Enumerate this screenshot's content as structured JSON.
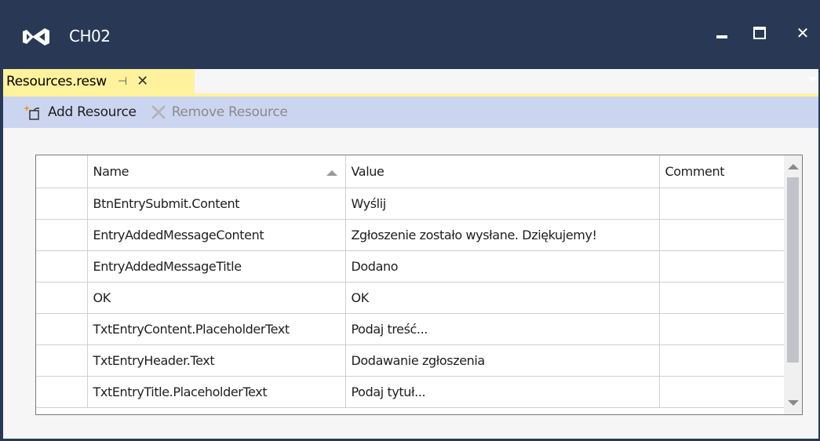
{
  "window": {
    "title": "CH02"
  },
  "tab": {
    "label": "Resources.resw",
    "pin_glyph": "⊣",
    "close_glyph": "✕"
  },
  "toolbar": {
    "add_label": "Add Resource",
    "remove_label": "Remove Resource"
  },
  "grid": {
    "columns": [
      "Name",
      "Value",
      "Comment"
    ],
    "sort_column": "Name",
    "sort_direction": "ascending",
    "rows": [
      {
        "name": "BtnEntrySubmit.Content",
        "value": "Wyślij",
        "comment": ""
      },
      {
        "name": "EntryAddedMessageContent",
        "value": "Zgłoszenie zostało wysłane. Dziękujemy!",
        "comment": ""
      },
      {
        "name": "EntryAddedMessageTitle",
        "value": "Dodano",
        "comment": ""
      },
      {
        "name": "OK",
        "value": "OK",
        "comment": ""
      },
      {
        "name": "TxtEntryContent.PlaceholderText",
        "value": "Podaj treść...",
        "comment": ""
      },
      {
        "name": "TxtEntryHeader.Text",
        "value": "Dodawanie zgłoszenia",
        "comment": ""
      },
      {
        "name": "TxtEntryTitle.PlaceholderText",
        "value": "Podaj tytuł...",
        "comment": ""
      }
    ]
  },
  "colors": {
    "titlebar": "#293955",
    "active_tab": "#fff29d",
    "toolbar": "#ccd5f0"
  },
  "icons": {
    "app": "visual-studio-logo-icon",
    "add": "add-resource-icon",
    "remove": "remove-resource-icon"
  }
}
